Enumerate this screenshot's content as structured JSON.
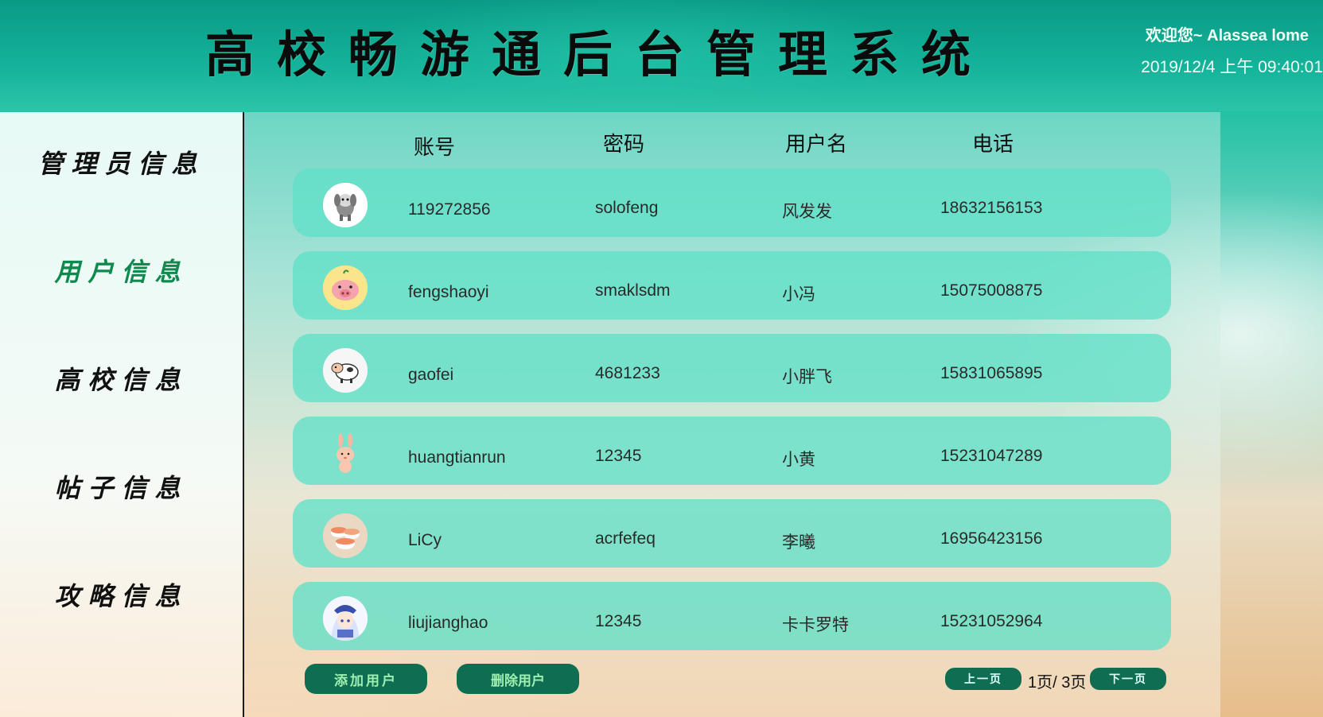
{
  "header": {
    "title": "高校畅游通后台管理系统",
    "welcome": "欢迎您~ Alassea lome",
    "datetime": "2019/12/4 上午 09:40:01"
  },
  "sidebar": {
    "items": [
      {
        "label": "管理员信息",
        "active": false
      },
      {
        "label": "用户信息",
        "active": true
      },
      {
        "label": "高校信息",
        "active": false
      },
      {
        "label": "帖子信息",
        "active": false
      },
      {
        "label": "攻略信息",
        "active": false
      }
    ]
  },
  "table": {
    "headers": [
      "账号",
      "密码",
      "用户名",
      "电话"
    ],
    "rows": [
      {
        "avatar": "dog-avatar-icon",
        "account": "119272856",
        "password": "solofeng",
        "username": "风发发",
        "phone": "18632156153"
      },
      {
        "avatar": "pig-avatar-icon",
        "account": "fengshaoyi",
        "password": "smaklsdm",
        "username": "小冯",
        "phone": "15075008875"
      },
      {
        "avatar": "cow-avatar-icon",
        "account": "gaofei",
        "password": "4681233",
        "username": "小胖飞",
        "phone": "15831065895"
      },
      {
        "avatar": "rabbit-avatar-icon",
        "account": "huangtianrun",
        "password": "12345",
        "username": "小黄",
        "phone": "15231047289"
      },
      {
        "avatar": "sushi-avatar-icon",
        "account": "LiCy",
        "password": "acrfefeq",
        "username": "李曦",
        "phone": "16956423156"
      },
      {
        "avatar": "anime-girl-avatar-icon",
        "account": "liujianghao",
        "password": "12345",
        "username": "卡卡罗特",
        "phone": "15231052964"
      }
    ]
  },
  "actions": {
    "add_user": "添加用户",
    "delete_user": "删除用户"
  },
  "pagination": {
    "prev": "上一页",
    "info": "1页/ 3页",
    "next": "下一页"
  },
  "colors": {
    "active_nav": "#0e8a4f",
    "button_bg": "#0f6e52",
    "row_bg": "#60e0c8"
  }
}
